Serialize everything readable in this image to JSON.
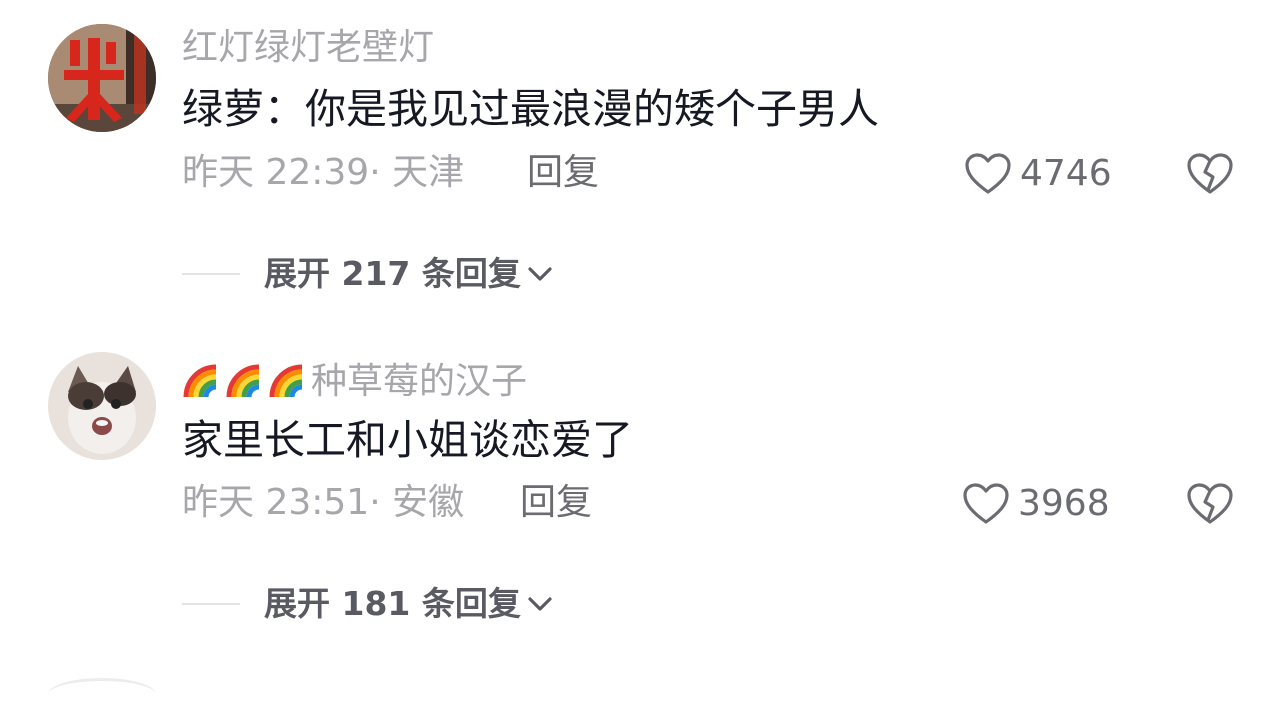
{
  "comments": [
    {
      "username": "红灯绿灯老壁灯",
      "avatar": "red-character-avatar",
      "text": "绿萝：你是我见过最浪漫的矮个子男人",
      "time": "昨天 22:39",
      "location": "天津",
      "reply_label": "回复",
      "likes": "4746",
      "expand_label": "展开 217 条回复"
    },
    {
      "username": "种草莓的汉子",
      "username_prefix_emoji": "rainbow-emoji-x3",
      "avatar": "cat-avatar",
      "text": "家里长工和小姐谈恋爱了",
      "time": "昨天 23:51",
      "location": "安徽",
      "reply_label": "回复",
      "likes": "3968",
      "expand_label": "展开 181 条回复"
    }
  ],
  "colors": {
    "text_primary": "#161823",
    "text_secondary": "#a6a6ab",
    "text_action": "#6b6b72"
  }
}
